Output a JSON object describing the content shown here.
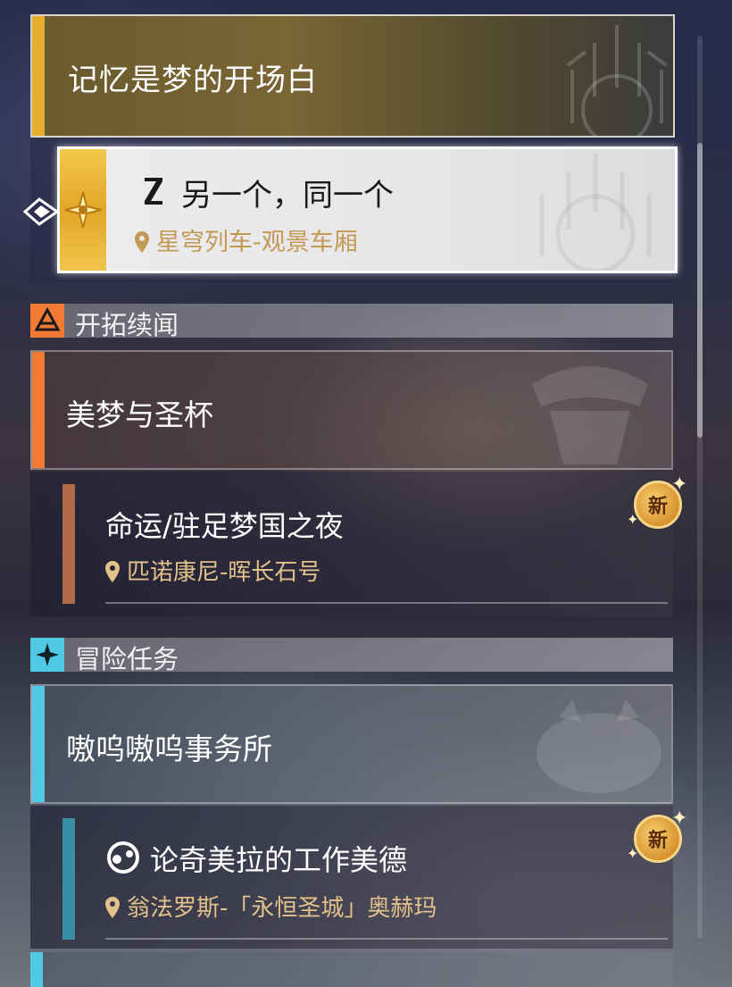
{
  "main_quest": {
    "title": "记忆是梦的开场白",
    "accent_color": "#e8ad2c",
    "selected": {
      "title": "另一个，同一个",
      "location": "星穹列车-观景车厢",
      "icon": "hourglass-icon"
    }
  },
  "categories": [
    {
      "label": "开拓续闻",
      "accent_color": "#f37a35",
      "icon": "trailblaze-icon",
      "group_title": "美梦与圣杯",
      "items": [
        {
          "title": "命运/驻足梦国之夜",
          "location": "匹诺康尼-晖长石号",
          "badge": "新"
        }
      ]
    },
    {
      "label": "冒险任务",
      "accent_color": "#4fc9e4",
      "icon": "adventure-icon",
      "group_title": "嗷呜嗷呜事务所",
      "items": [
        {
          "title": "论奇美拉的工作美德",
          "location": "翁法罗斯-「永恒圣城」奥赫玛",
          "badge": "新"
        }
      ]
    }
  ]
}
